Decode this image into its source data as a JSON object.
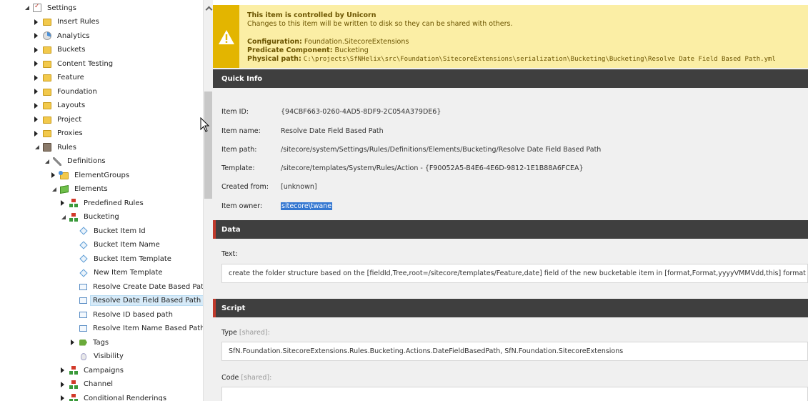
{
  "tree": {
    "items": [
      {
        "label": "Settings",
        "icon": "settings-icon",
        "expander": "open"
      },
      {
        "label": "Insert Rules",
        "icon": "folder-icon",
        "expander": "closed"
      },
      {
        "label": "Analytics",
        "icon": "analytics-icon",
        "expander": "closed"
      },
      {
        "label": "Buckets",
        "icon": "folder-icon",
        "expander": "closed"
      },
      {
        "label": "Content Testing",
        "icon": "folder-icon",
        "expander": "closed"
      },
      {
        "label": "Feature",
        "icon": "folder-icon",
        "expander": "closed"
      },
      {
        "label": "Foundation",
        "icon": "folder-icon",
        "expander": "closed"
      },
      {
        "label": "Layouts",
        "icon": "folder-icon",
        "expander": "closed"
      },
      {
        "label": "Project",
        "icon": "folder-icon",
        "expander": "closed"
      },
      {
        "label": "Proxies",
        "icon": "folder-icon",
        "expander": "closed"
      },
      {
        "label": "Rules",
        "icon": "rules-icon",
        "expander": "open"
      },
      {
        "label": "Definitions",
        "icon": "wrench-icon",
        "expander": "open"
      },
      {
        "label": "ElementGroups",
        "icon": "element-groups-icon",
        "expander": "closed"
      },
      {
        "label": "Elements",
        "icon": "elements-icon",
        "expander": "open"
      },
      {
        "label": "Predefined Rules",
        "icon": "rule-tree-icon",
        "expander": "closed"
      },
      {
        "label": "Bucketing",
        "icon": "rule-tree-icon",
        "expander": "open"
      },
      {
        "label": "Bucket Item Id",
        "icon": "diamond-icon",
        "expander": "none"
      },
      {
        "label": "Bucket Item Name",
        "icon": "diamond-icon",
        "expander": "none"
      },
      {
        "label": "Bucket Item Template",
        "icon": "diamond-icon",
        "expander": "none"
      },
      {
        "label": "New Item Template",
        "icon": "diamond-icon",
        "expander": "none"
      },
      {
        "label": "Resolve Create Date Based Path",
        "icon": "action-icon",
        "expander": "none"
      },
      {
        "label": "Resolve Date Field Based Path",
        "icon": "action-icon",
        "expander": "none",
        "selected": true
      },
      {
        "label": "Resolve ID based path",
        "icon": "action-icon",
        "expander": "none"
      },
      {
        "label": "Resolve Item Name Based Path",
        "icon": "action-icon",
        "expander": "none"
      },
      {
        "label": "Tags",
        "icon": "tag-icon",
        "expander": "closed"
      },
      {
        "label": "Visibility",
        "icon": "bulb-icon",
        "expander": "none"
      },
      {
        "label": "Campaigns",
        "icon": "rule-tree-icon",
        "expander": "closed"
      },
      {
        "label": "Channel",
        "icon": "rule-tree-icon",
        "expander": "closed"
      },
      {
        "label": "Conditional Renderings",
        "icon": "rule-tree-icon",
        "expander": "closed"
      }
    ]
  },
  "warning": {
    "title": "This item is controlled by Unicorn",
    "subtitle": "Changes to this item will be written to disk so they can be shared with others.",
    "config_label": "Configuration:",
    "config_value": "Foundation.SitecoreExtensions",
    "predicate_label": "Predicate Component:",
    "predicate_value": "Bucketing",
    "path_label": "Physical path:",
    "path_value": "C:\\projects\\SfNHelix\\src\\Foundation\\SitecoreExtensions\\serialization\\Bucketing\\Bucketing\\Resolve Date Field Based Path.yml"
  },
  "quick_info": {
    "heading": "Quick Info",
    "rows": [
      {
        "key": "Item ID:",
        "value": "{94CBF663-0260-4AD5-8DF9-2C054A379DE6}"
      },
      {
        "key": "Item name:",
        "value": "Resolve Date Field Based Path"
      },
      {
        "key": "Item path:",
        "value": "/sitecore/system/Settings/Rules/Definitions/Elements/Bucketing/Resolve Date Field Based Path"
      },
      {
        "key": "Template:",
        "value": "/sitecore/templates/System/Rules/Action - {F90052A5-B4E6-4E6D-9812-1E1B88A6FCEA}"
      },
      {
        "key": "Created from:",
        "value": "[unknown]"
      },
      {
        "key": "Item owner:",
        "value": "sitecore\\twane"
      }
    ]
  },
  "data_section": {
    "heading": "Data",
    "text_label": "Text:",
    "text_value": "create the folder structure based on the [fieldId,Tree,root=/sitecore/templates/Feature,date] field of the new bucketable item in [format,Format,yyyyVMMVdd,this] format"
  },
  "script_section": {
    "heading": "Script",
    "type_label": "Type",
    "type_shared": "[shared]:",
    "type_value": "SfN.Foundation.SitecoreExtensions.Rules.Bucketing.Actions.DateFieldBasedPath, SfN.Foundation.SitecoreExtensions",
    "code_label": "Code",
    "code_shared": "[shared]:",
    "code_value": ""
  },
  "colors": {
    "warning_bg": "#fbeea5",
    "warning_bar": "#e3b500",
    "section_header": "#3f3f3f",
    "section_accent": "#c0392b",
    "selection": "#3477d1"
  }
}
